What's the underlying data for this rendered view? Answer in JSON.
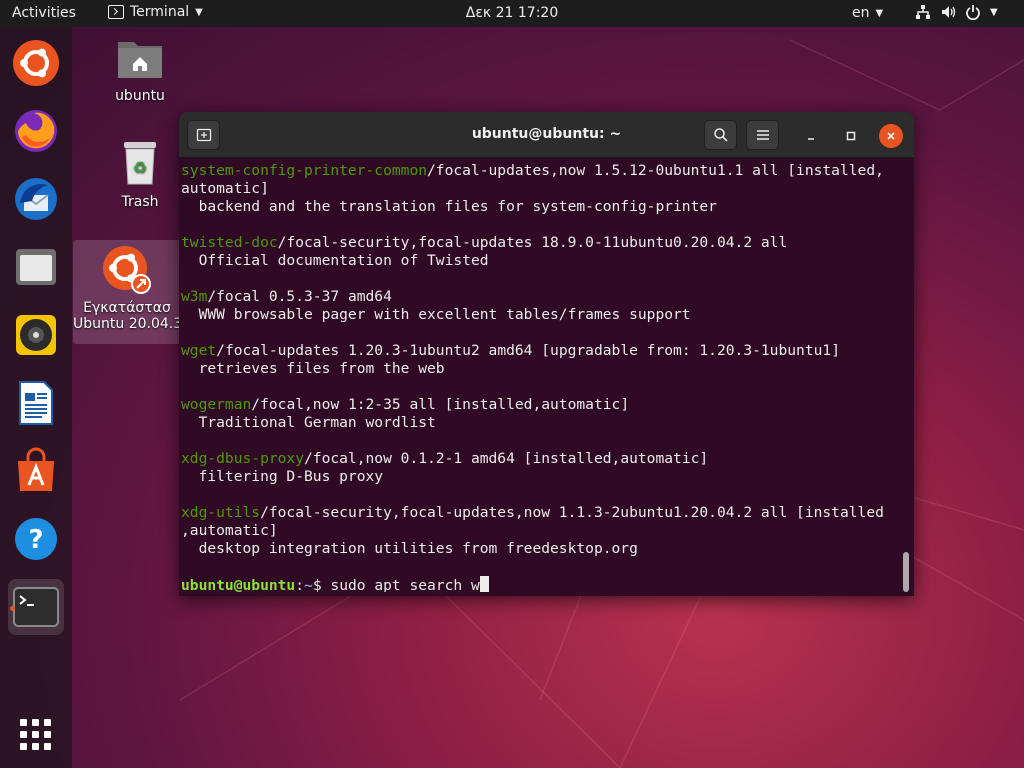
{
  "topbar": {
    "activities": "Activities",
    "app_name": "Terminal",
    "clock": "Δεκ 21  17:20",
    "language": "en"
  },
  "dock": {
    "items": [
      {
        "name": "ubuntu-installer"
      },
      {
        "name": "firefox"
      },
      {
        "name": "thunderbird"
      },
      {
        "name": "files"
      },
      {
        "name": "rhythmbox"
      },
      {
        "name": "libreoffice-writer"
      },
      {
        "name": "ubuntu-software"
      },
      {
        "name": "help"
      },
      {
        "name": "terminal",
        "active": true
      },
      {
        "name": "show-applications"
      }
    ]
  },
  "desktop": {
    "home_label": "ubuntu",
    "trash_label": "Trash",
    "installer_label_line1": "Εγκατάστασ",
    "installer_label_line2": "Ubuntu 20.04.3"
  },
  "terminal": {
    "title": "ubuntu@ubuntu: ~",
    "lines": [
      {
        "pkg": "system-config-printer-common",
        "rest": "/focal-updates,now 1.5.12-0ubuntu1.1 all [installed,"
      },
      {
        "text": "automatic]"
      },
      {
        "text": "  backend and the translation files for system-config-printer"
      },
      {
        "text": ""
      },
      {
        "pkg": "twisted-doc",
        "rest": "/focal-security,focal-updates 18.9.0-11ubuntu0.20.04.2 all"
      },
      {
        "text": "  Official documentation of Twisted"
      },
      {
        "text": ""
      },
      {
        "pkg": "w3m",
        "rest": "/focal 0.5.3-37 amd64"
      },
      {
        "text": "  WWW browsable pager with excellent tables/frames support"
      },
      {
        "text": ""
      },
      {
        "pkg": "wget",
        "rest": "/focal-updates 1.20.3-1ubuntu2 amd64 [upgradable from: 1.20.3-1ubuntu1]"
      },
      {
        "text": "  retrieves files from the web"
      },
      {
        "text": ""
      },
      {
        "pkg": "wogerman",
        "rest": "/focal,now 1:2-35 all [installed,automatic]"
      },
      {
        "text": "  Traditional German wordlist"
      },
      {
        "text": ""
      },
      {
        "pkg": "xdg-dbus-proxy",
        "rest": "/focal,now 0.1.2-1 amd64 [installed,automatic]"
      },
      {
        "text": "  filtering D-Bus proxy"
      },
      {
        "text": ""
      },
      {
        "pkg": "xdg-utils",
        "rest": "/focal-security,focal-updates,now 1.1.3-2ubuntu1.20.04.2 all [installed"
      },
      {
        "text": ",automatic]"
      },
      {
        "text": "  desktop integration utilities from freedesktop.org"
      },
      {
        "text": ""
      }
    ],
    "prompt_user": "ubuntu@ubuntu",
    "prompt_sep": ":",
    "prompt_path": "~",
    "prompt_symbol": "$ ",
    "command": "sudo apt search w"
  },
  "colors": {
    "ubuntu_orange": "#e95420",
    "terminal_bg": "#300a24",
    "package_green": "#4e9a06"
  }
}
